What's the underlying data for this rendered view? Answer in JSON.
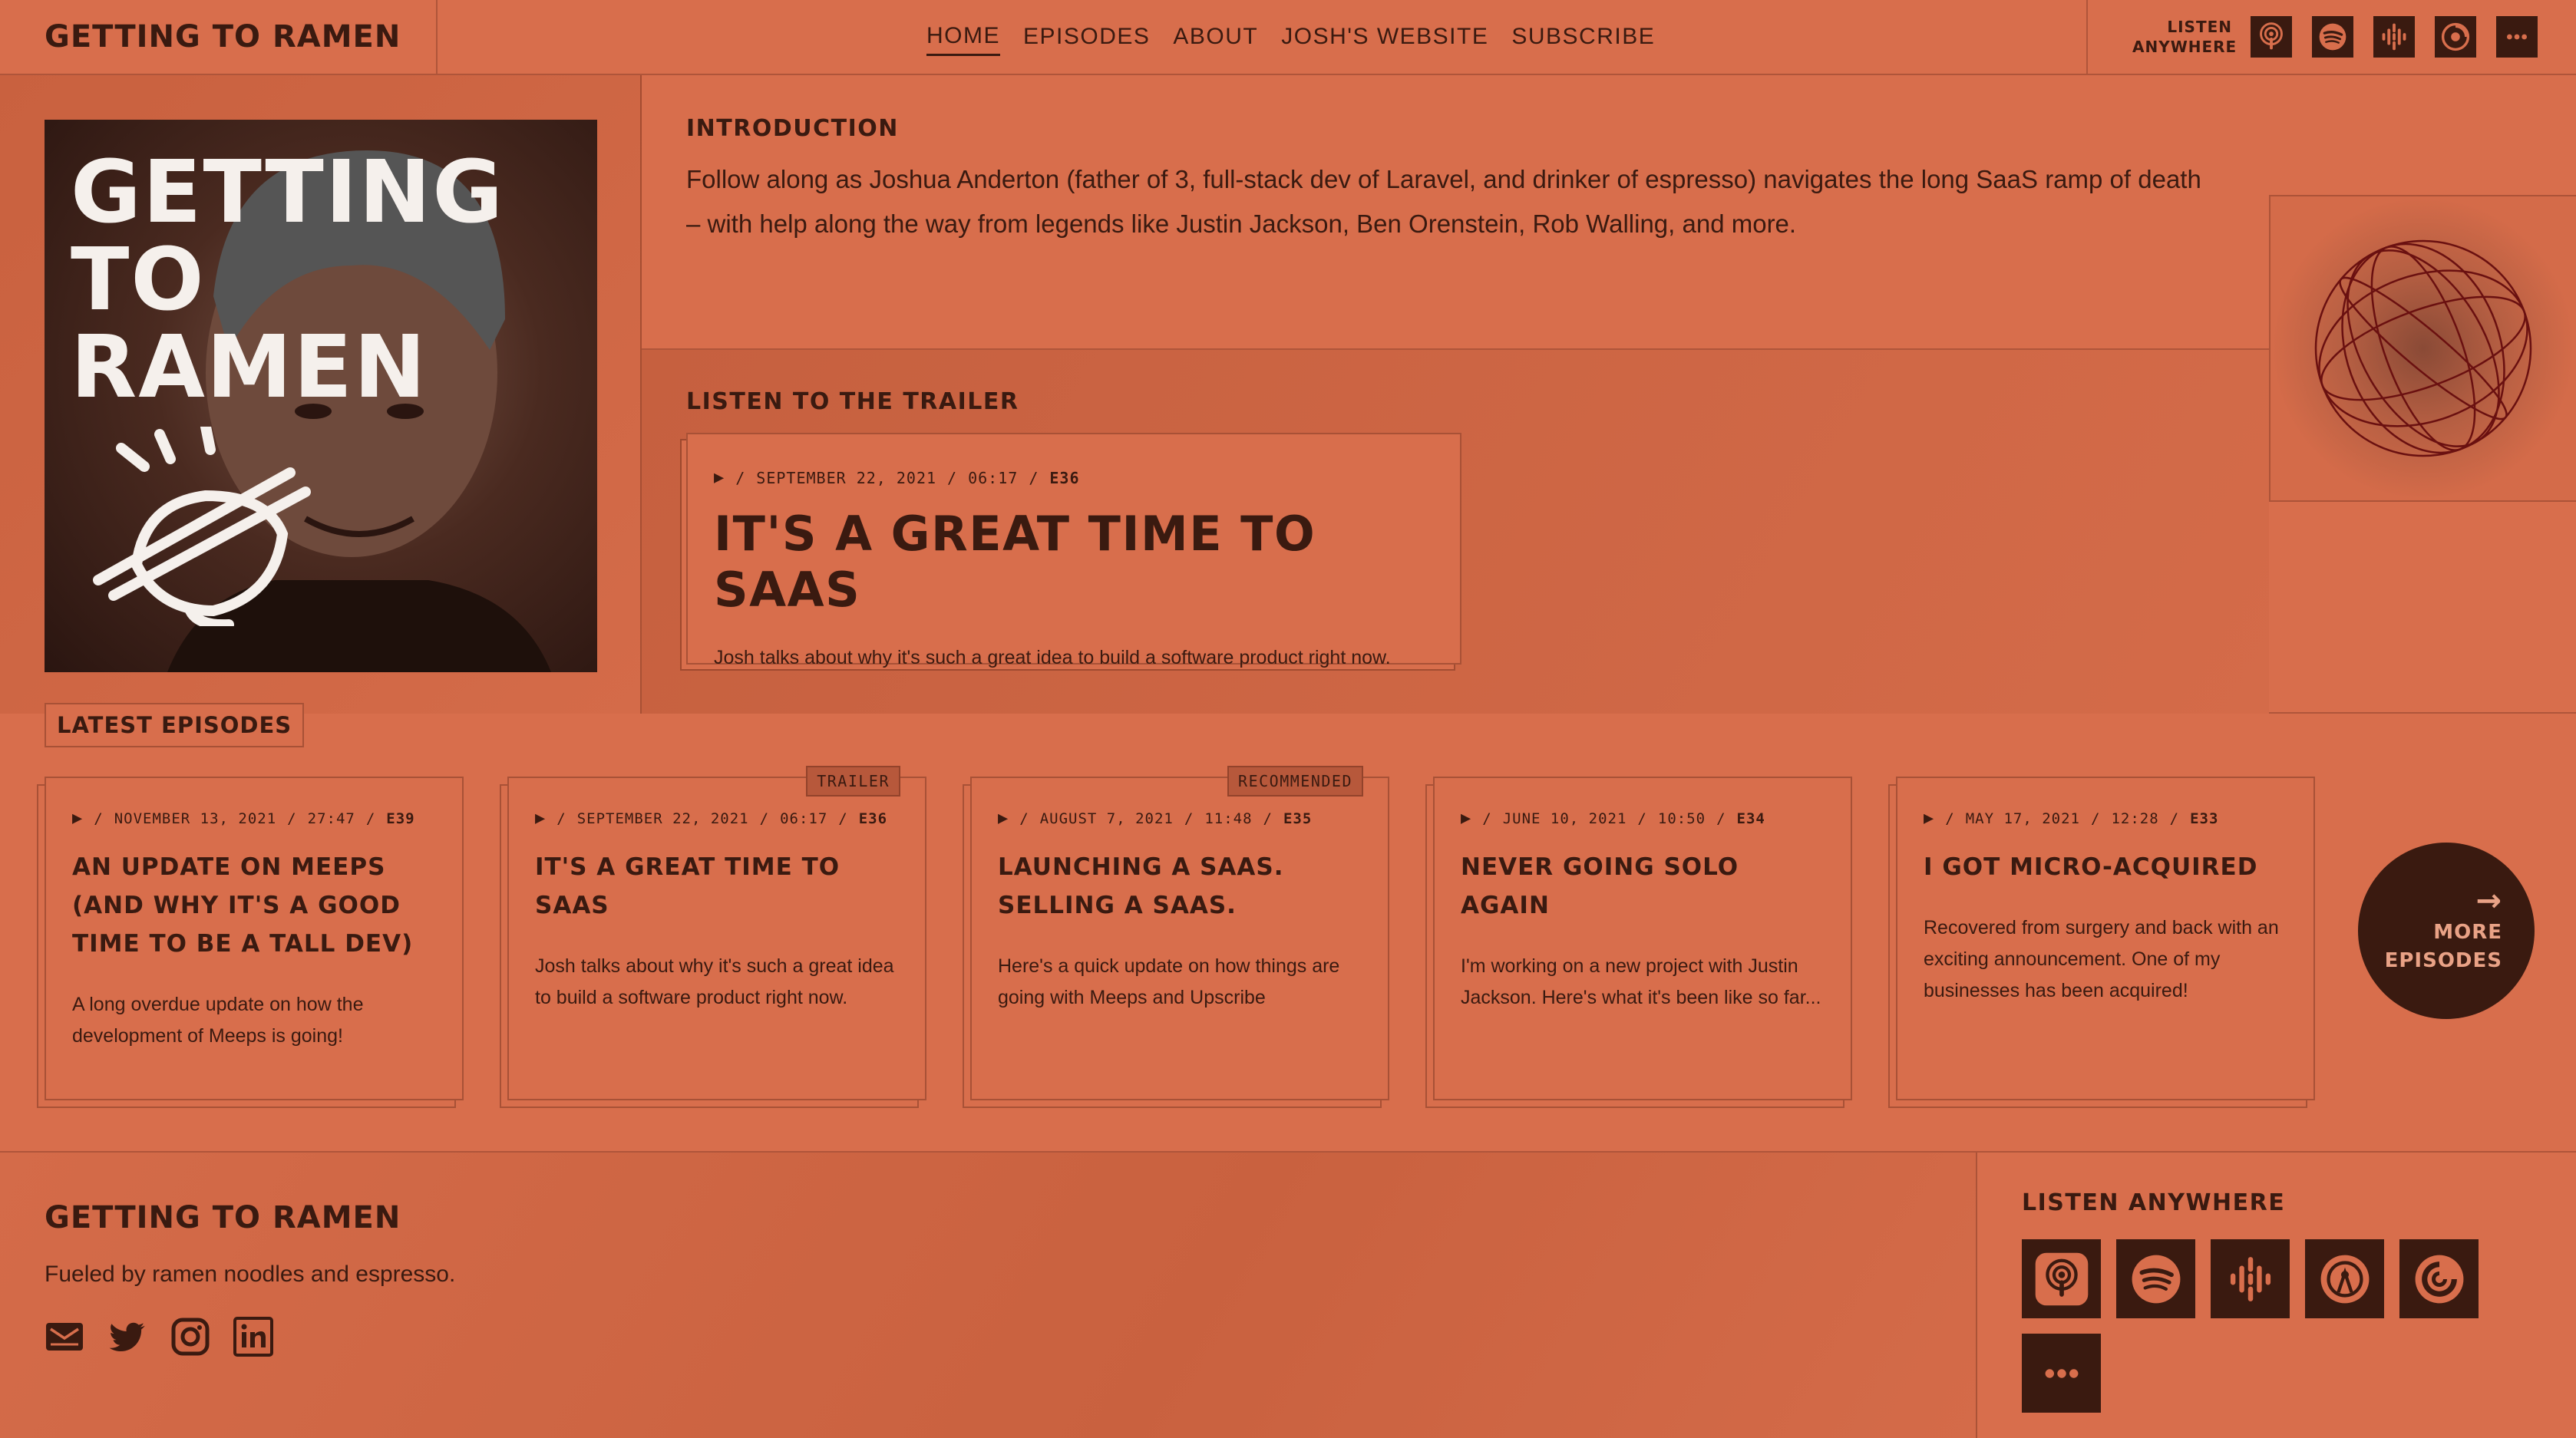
{
  "header": {
    "brand": "GETTING TO RAMEN",
    "nav": [
      "HOME",
      "EPISODES",
      "ABOUT",
      "JOSH'S WEBSITE",
      "SUBSCRIBE"
    ],
    "listen_label_line1": "LISTEN",
    "listen_label_line2": "ANYWHERE"
  },
  "cover": {
    "title_line1": "GETTING",
    "title_line2": "TO",
    "title_line3": "RAMEN"
  },
  "intro": {
    "heading": "INTRODUCTION",
    "text_before": "Follow along as Joshua Anderton (father of 3, full-stack dev of Laravel, and drinker of espresso) navigates the long SaaS ramp of death – with help along the way from legends like ",
    "link1": "Justin Jackson",
    "sep1": ", ",
    "link2": "Ben Orenstein",
    "sep2": ", ",
    "link3": "Rob Walling",
    "text_after": ", and more."
  },
  "trailer": {
    "heading": "LISTEN TO THE TRAILER",
    "date": "SEPTEMBER 22, 2021",
    "duration": "06:17",
    "episode": "E36",
    "title": "IT'S A GREAT TIME TO SAAS",
    "description": "Josh talks about why it's such a great idea to build a software product right now."
  },
  "latest": {
    "heading": "LATEST EPISODES",
    "episodes": [
      {
        "date": "NOVEMBER 13, 2021",
        "duration": "27:47",
        "number": "E39",
        "title": "AN UPDATE ON MEEPS (AND WHY IT'S A GOOD TIME TO BE A TALL DEV)",
        "description": "A long overdue update on how the development of Meeps is going!",
        "badge": ""
      },
      {
        "date": "SEPTEMBER 22, 2021",
        "duration": "06:17",
        "number": "E36",
        "title": "IT'S A GREAT TIME TO SAAS",
        "description": "Josh talks about why it's such a great idea to build a software product right now.",
        "badge": "TRAILER"
      },
      {
        "date": "AUGUST 7, 2021",
        "duration": "11:48",
        "number": "E35",
        "title": "LAUNCHING A SAAS. SELLING A SAAS.",
        "description": "Here's a quick update on how things are going with Meeps and Upscribe",
        "badge": "RECOMMENDED"
      },
      {
        "date": "JUNE 10, 2021",
        "duration": "10:50",
        "number": "E34",
        "title": "NEVER GOING SOLO AGAIN",
        "description": "I'm working on a new project with Justin Jackson. Here's what it's been like so far...",
        "badge": ""
      },
      {
        "date": "MAY 17, 2021",
        "duration": "12:28",
        "number": "E33",
        "title": "I GOT MICRO-ACQUIRED",
        "description": "Recovered from surgery and back with an exciting announcement. One of my businesses has been acquired!",
        "badge": ""
      }
    ],
    "more_line1": "MORE",
    "more_line2": "EPISODES",
    "arrow": "→"
  },
  "footer": {
    "brand": "GETTING TO RAMEN",
    "tagline": "Fueled by ramen noodles and espresso.",
    "listen_heading": "LISTEN ANYWHERE"
  },
  "separators": {
    "slash": "/",
    "play": "▶",
    "dots": "···"
  },
  "icons": {
    "platforms": [
      "apple-podcasts-icon",
      "spotify-icon",
      "google-podcasts-icon",
      "overcast-icon",
      "pocket-casts-icon",
      "more-icon"
    ],
    "social": [
      "email-icon",
      "twitter-icon",
      "instagram-icon",
      "linkedin-icon"
    ]
  },
  "colors": {
    "background": "#D86E4C",
    "ink": "#3A1A10",
    "badge": "#B7583B"
  }
}
